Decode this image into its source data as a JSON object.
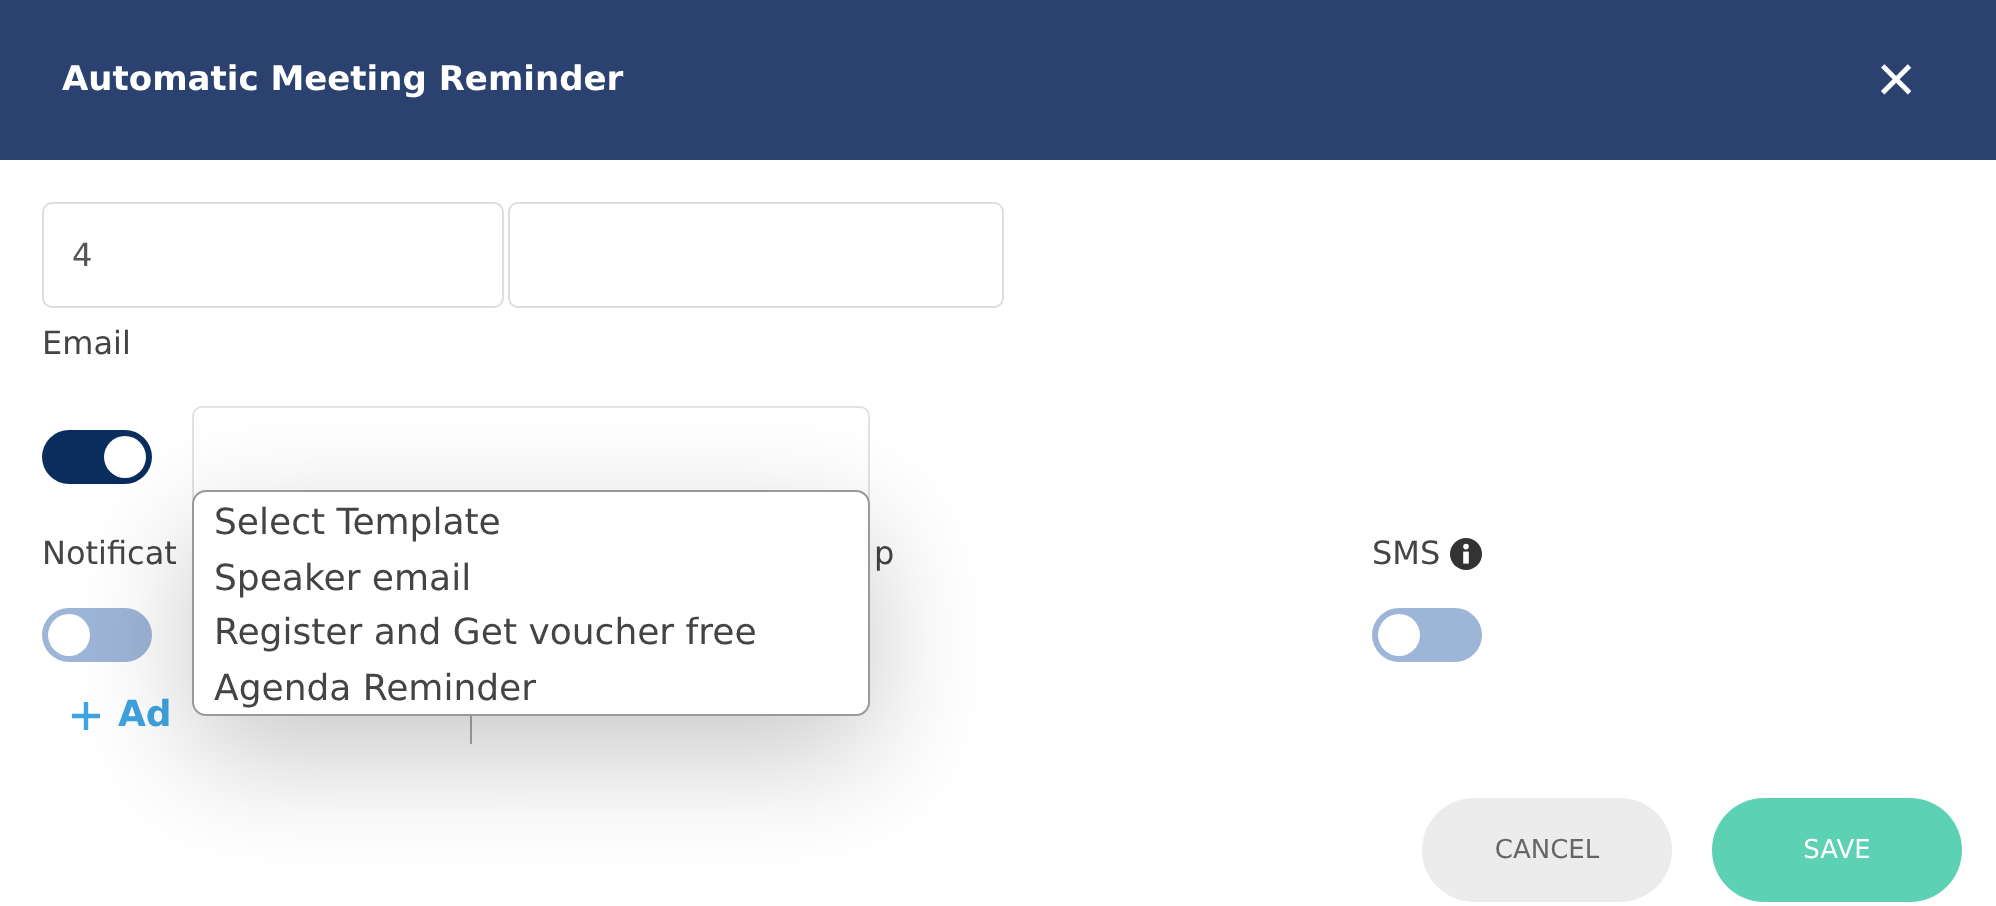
{
  "dialog": {
    "title": "Automatic Meeting Reminder",
    "close": "×"
  },
  "fields": [
    {
      "kind": "filled",
      "value": "4"
    },
    {
      "kind": "blank"
    }
  ],
  "email": {
    "label": "Email",
    "on": true
  },
  "template_menu": {
    "options": [
      {
        "label": "Select Template"
      },
      {
        "label": "Speaker email"
      },
      {
        "label": "Register and Get voucher free"
      },
      {
        "label": "Agenda Reminder"
      }
    ]
  },
  "channels": [
    {
      "label": "Notificat",
      "on": false
    },
    {
      "label": "p"
    },
    {
      "label": "SMS",
      "on": false,
      "info": true
    }
  ],
  "add_link": {
    "label": "Ad"
  },
  "buttons": [
    {
      "label": "CANCEL",
      "kind": "secondary"
    },
    {
      "label": "SAVE",
      "kind": "primary"
    }
  ]
}
